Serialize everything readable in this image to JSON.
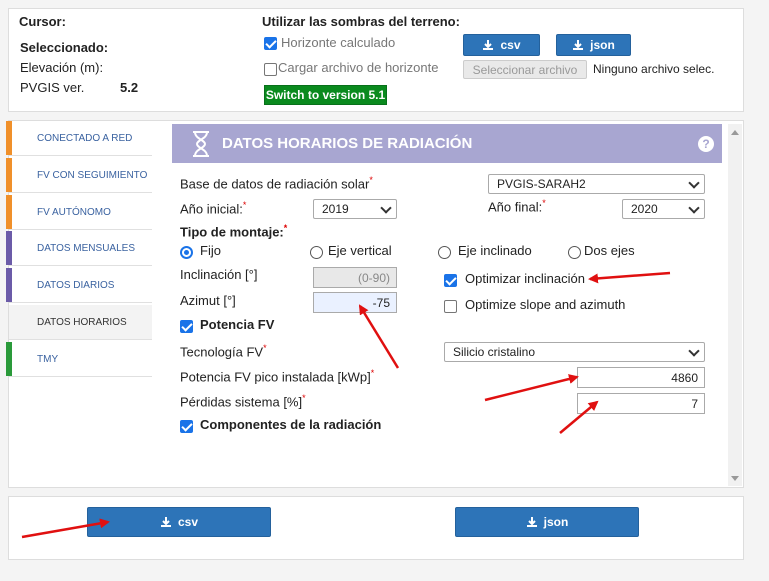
{
  "top": {
    "cursor_label": "Cursor:",
    "selected_label": "Seleccionado:",
    "elevation_label": "Elevación (m):",
    "pvgis_label": "PVGIS ver.",
    "pvgis_value": "5.2",
    "terrain_title": "Utilizar las sombras del terreno:",
    "calc_horizon_label": "Horizonte calculado",
    "load_horizon_label": "Cargar archivo de horizonte",
    "csv_label": "csv",
    "json_label": "json",
    "select_file_label": "Seleccionar archivo",
    "no_file_label": "Ninguno archivo selec.",
    "switch_label": "Switch to version 5.1"
  },
  "tabs": [
    {
      "label": "CONECTADO A RED",
      "color": "#f0902a"
    },
    {
      "label": "FV CON SEGUIMIENTO",
      "color": "#f0902a"
    },
    {
      "label": "FV AUTÓNOMO",
      "color": "#f0902a"
    },
    {
      "label": "DATOS MENSUALES",
      "color": "#6b5ba8"
    },
    {
      "label": "DATOS DIARIOS",
      "color": "#6b5ba8"
    },
    {
      "label": "DATOS HORARIOS",
      "color": "#ffffff"
    },
    {
      "label": "TMY",
      "color": "#2a9a3a"
    }
  ],
  "form": {
    "header_title": "DATOS HORARIOS DE RADIACIÓN",
    "help": "?",
    "db_label": "Base de datos de radiación solar",
    "db_value": "PVGIS-SARAH2",
    "start_year_label": "Año inicial:",
    "start_year_value": "2019",
    "end_year_label": "Año final:",
    "end_year_value": "2020",
    "mount_label": "Tipo de montaje:",
    "mount_fixed": "Fijo",
    "mount_vertical": "Eje vertical",
    "mount_inclined": "Eje inclinado",
    "mount_two": "Dos ejes",
    "incl_label": "Inclinación [°]",
    "incl_placeholder": "(0-90)",
    "azimuth_label": "Azimut [°]",
    "azimuth_value": "-75",
    "opt_incl_label": "Optimizar inclinación",
    "opt_slope_label": "Optimize slope and azimuth",
    "pv_power_label": "Potencia FV",
    "tech_label": "Tecnología FV",
    "tech_value": "Silicio cristalino",
    "peak_label": "Potencia FV pico instalada [kWp]",
    "peak_value": "4860",
    "loss_label": "Pérdidas sistema [%]",
    "loss_value": "7",
    "components_label": "Componentes de la radiación",
    "req": "*"
  },
  "bottom": {
    "csv_label": "csv",
    "json_label": "json"
  },
  "colors": {
    "header": "#a8a6d1",
    "button_blue": "#2d74b8",
    "switch_green": "#0a8a1e",
    "arrow_red": "#e01010"
  }
}
